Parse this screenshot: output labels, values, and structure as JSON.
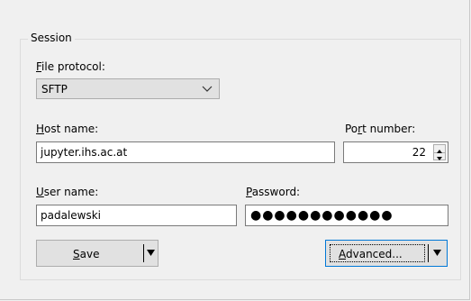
{
  "session": {
    "group_title": "Session",
    "file_protocol": {
      "label_prefix": "",
      "label_accel": "F",
      "label_rest": "ile protocol:",
      "value": "SFTP"
    },
    "host": {
      "label_accel": "H",
      "label_rest": "ost name:",
      "value": "jupyter.ihs.ac.at"
    },
    "port": {
      "label_prefix": "Po",
      "label_accel": "r",
      "label_rest": "t number:",
      "value": "22"
    },
    "user": {
      "label_accel": "U",
      "label_rest": "ser name:",
      "value": "padalewski"
    },
    "password": {
      "label_accel": "P",
      "label_rest": "assword:",
      "masked": "●●●●●●●●●●●●"
    },
    "save_button": {
      "label_accel": "S",
      "label_rest": "ave"
    },
    "advanced_button": {
      "label_prefix": "",
      "label_accel": "A",
      "label_rest": "dvanced..."
    }
  },
  "colors": {
    "background": "#f0f0f0",
    "focus_border": "#0078d7",
    "button_face": "#e1e1e1"
  },
  "icons": {
    "dropdown": "chevron-down-icon",
    "spin_up": "spin-up-icon",
    "spin_down": "spin-down-icon",
    "split_arrow": "triangle-down-icon"
  }
}
